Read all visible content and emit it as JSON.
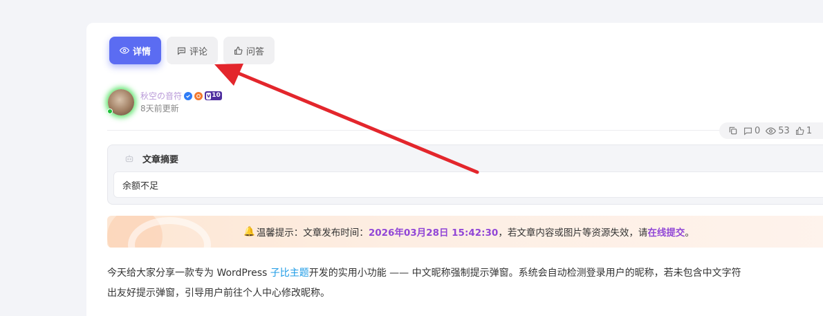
{
  "tabs": [
    {
      "label": "详情",
      "icon": "eye-icon",
      "active": true
    },
    {
      "label": "评论",
      "icon": "comment-icon",
      "active": false
    },
    {
      "label": "问答",
      "icon": "thumb-up-icon",
      "active": false
    }
  ],
  "author": {
    "name": "秋空の音符",
    "level": "10",
    "updated": "8天前更新"
  },
  "stats": {
    "comments": "0",
    "views": "53",
    "likes": "1"
  },
  "summary": {
    "title": "文章摘要",
    "content": "余额不足"
  },
  "notice": {
    "prefix": "温馨提示：文章发布时间：",
    "datetime": "2026年03月28日 15:42:30",
    "middle": "，若文章内容或图片等资源失效，请",
    "link": "在线提交",
    "suffix": "。"
  },
  "article": {
    "line1_before": "今天给大家分享一款专为 WordPress ",
    "line1_link": "子比主题",
    "line1_after": "开发的实用小功能 —— 中文昵称强制提示弹窗。系统会自动检测登录用户的昵称，若未包含中文字符",
    "line2": "出友好提示弹窗，引导用户前往个人中心修改昵称。"
  },
  "colors": {
    "accent": "#5b6cf2",
    "highlight": "#9146d6",
    "link": "#1d9be6",
    "arrow": "#e3262c"
  }
}
